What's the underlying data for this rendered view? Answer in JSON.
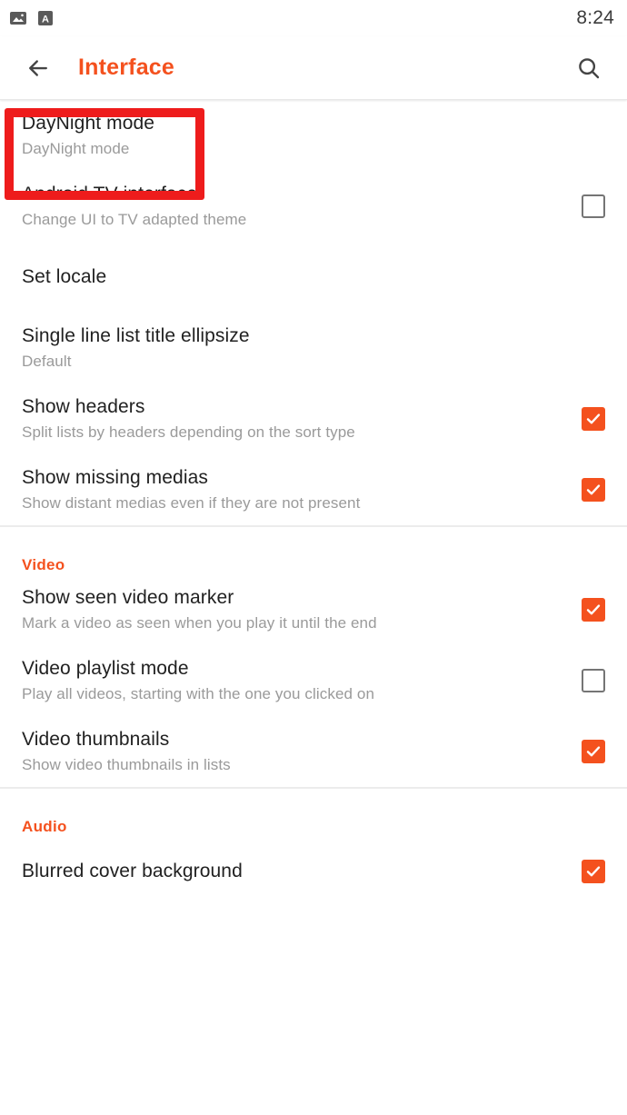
{
  "status_bar": {
    "icons": [
      "image-icon",
      "translate-a-icon"
    ],
    "time": "8:24"
  },
  "toolbar": {
    "back_icon": "back-arrow-icon",
    "title": "Interface",
    "search_icon": "search-icon",
    "title_color": "#f4511e"
  },
  "colors": {
    "accent": "#f4511e",
    "title_text": "#212121",
    "subtitle_text": "#9a9a9a",
    "highlight": "#ee1c1c",
    "checkbox_off_border": "#757575"
  },
  "highlight": {
    "target": "daynight-mode-row",
    "color": "#ee1c1c"
  },
  "sections": [
    {
      "header": null,
      "rows": [
        {
          "name": "daynight-mode",
          "title": "DayNight mode",
          "subtitle": "DayNight mode",
          "control": "none",
          "checked": null
        },
        {
          "name": "android-tv-interface",
          "title": "Android TV interface",
          "subtitle": "Change UI to TV adapted theme",
          "control": "checkbox",
          "checked": false
        },
        {
          "name": "set-locale",
          "title": "Set locale",
          "subtitle": null,
          "control": "none",
          "checked": null
        },
        {
          "name": "single-line-list-title-ellipsize",
          "title": "Single line list title ellipsize",
          "subtitle": "Default",
          "control": "none",
          "checked": null
        },
        {
          "name": "show-headers",
          "title": "Show headers",
          "subtitle": "Split lists by headers depending on the sort type",
          "control": "checkbox",
          "checked": true
        },
        {
          "name": "show-missing-medias",
          "title": "Show missing medias",
          "subtitle": "Show distant medias even if they are not present",
          "control": "checkbox",
          "checked": true
        }
      ]
    },
    {
      "header": "Video",
      "rows": [
        {
          "name": "show-seen-video-marker",
          "title": "Show seen video marker",
          "subtitle": "Mark a video as seen when you play it until the end",
          "control": "checkbox",
          "checked": true
        },
        {
          "name": "video-playlist-mode",
          "title": "Video playlist mode",
          "subtitle": "Play all videos, starting with the one you clicked on",
          "control": "checkbox",
          "checked": false
        },
        {
          "name": "video-thumbnails",
          "title": "Video thumbnails",
          "subtitle": "Show video thumbnails in lists",
          "control": "checkbox",
          "checked": true
        }
      ]
    },
    {
      "header": "Audio",
      "rows": [
        {
          "name": "blurred-cover-background",
          "title": "Blurred cover background",
          "subtitle": null,
          "control": "checkbox",
          "checked": true
        }
      ]
    }
  ]
}
